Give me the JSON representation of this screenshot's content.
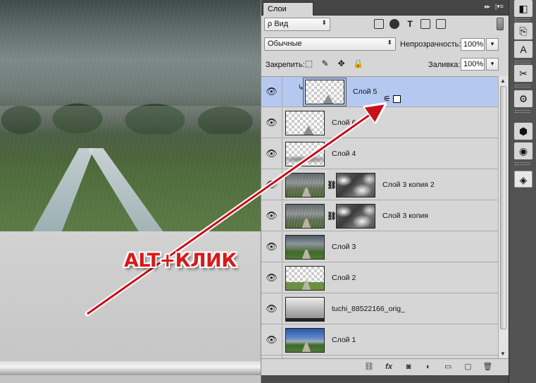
{
  "panel": {
    "tab_label": "Слои",
    "collapse_glyph": "▸▸",
    "menu_glyph": "|▾≡"
  },
  "filter": {
    "label": "Вид",
    "search_glyph": "ρ",
    "arrow": "⬍",
    "icon_t": "T"
  },
  "blend": {
    "mode": "Обычные",
    "arrow": "⬍",
    "opacity_label": "Непрозрачность:",
    "opacity_value": "100%",
    "dropdown_glyph": "▾"
  },
  "lock": {
    "label": "Закрепить:",
    "icons": [
      "⬚",
      "✎",
      "✥",
      "🔒"
    ],
    "fill_label": "Заливка:",
    "fill_value": "100%",
    "dropdown_glyph": "▾"
  },
  "layers": [
    {
      "name": "Слой 5",
      "selected": true,
      "clipped": true,
      "thumb": "checker-tent"
    },
    {
      "name": "Слой 6",
      "selected": false,
      "thumb": "checker-tent"
    },
    {
      "name": "Слой 4",
      "selected": false,
      "thumb": "checker-cloud"
    },
    {
      "name": "Слой 3 копия 2",
      "selected": false,
      "thumb": "rain",
      "mask": true
    },
    {
      "name": "Слой 3 копия",
      "selected": false,
      "thumb": "rain",
      "mask": true
    },
    {
      "name": "Слой 3",
      "selected": false,
      "thumb": "land"
    },
    {
      "name": "Слой 2",
      "selected": false,
      "thumb": "checker-road"
    },
    {
      "name": "tuchi_88522166_orig_",
      "selected": false,
      "thumb": "cloud-dark"
    },
    {
      "name": "Слой 1",
      "selected": false,
      "thumb": "land-sky"
    },
    {
      "name": "",
      "selected": false,
      "thumb": "land-sky"
    }
  ],
  "glyphs": {
    "eye": "👁",
    "chain": "⛓",
    "clip_arrow": "↳",
    "scroll_up": "▲",
    "scroll_down": "▼"
  },
  "footer": {
    "link": "⛓",
    "fx": "fx",
    "mask": "◙",
    "adjust": "◐",
    "folder": "▭",
    "new": "▢",
    "trash": "🗑"
  },
  "dock": {
    "icons": [
      "◧",
      "⎘",
      "A",
      "✂",
      "⚙",
      "⬢",
      "◉",
      "◈"
    ]
  },
  "annotation": {
    "caption": "ALT+КЛИК",
    "cursor_glyph": "⚟",
    "arrow_color": "#c8101a"
  }
}
